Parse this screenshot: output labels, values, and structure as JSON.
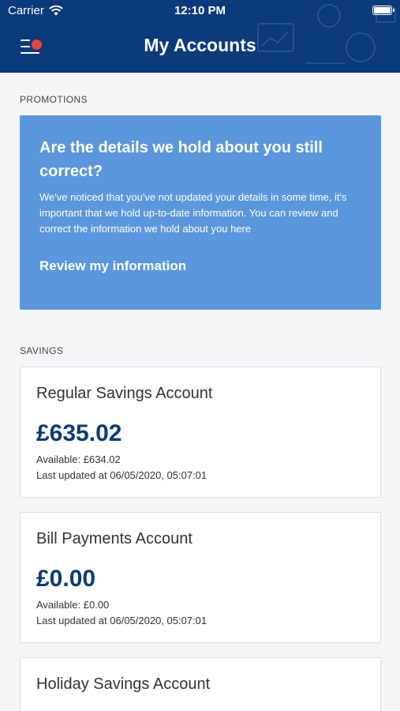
{
  "status_bar": {
    "carrier": "Carrier",
    "time": "12:10 PM"
  },
  "header": {
    "title": "My Accounts",
    "menu_icon": "menu-icon",
    "notification_color": "#e8423a"
  },
  "colors": {
    "brand": "#0b3b7a",
    "promo": "#5b97dc"
  },
  "promotions": {
    "label": "PROMOTIONS",
    "title": "Are the details we hold about you still correct?",
    "body": "We've noticed that you've not updated your details in some time, it's important that we hold up-to-date information. You can review and correct the information we hold about you here",
    "link": "Review my information"
  },
  "savings": {
    "label": "SAVINGS",
    "accounts": [
      {
        "name": "Regular Savings Account",
        "balance": "£635.02",
        "available": "Available: £634.02",
        "updated": "Last updated at 06/05/2020, 05:07:01"
      },
      {
        "name": "Bill Payments Account",
        "balance": "£0.00",
        "available": "Available: £0.00",
        "updated": "Last updated at 06/05/2020, 05:07:01"
      },
      {
        "name": "Holiday Savings Account"
      }
    ]
  }
}
